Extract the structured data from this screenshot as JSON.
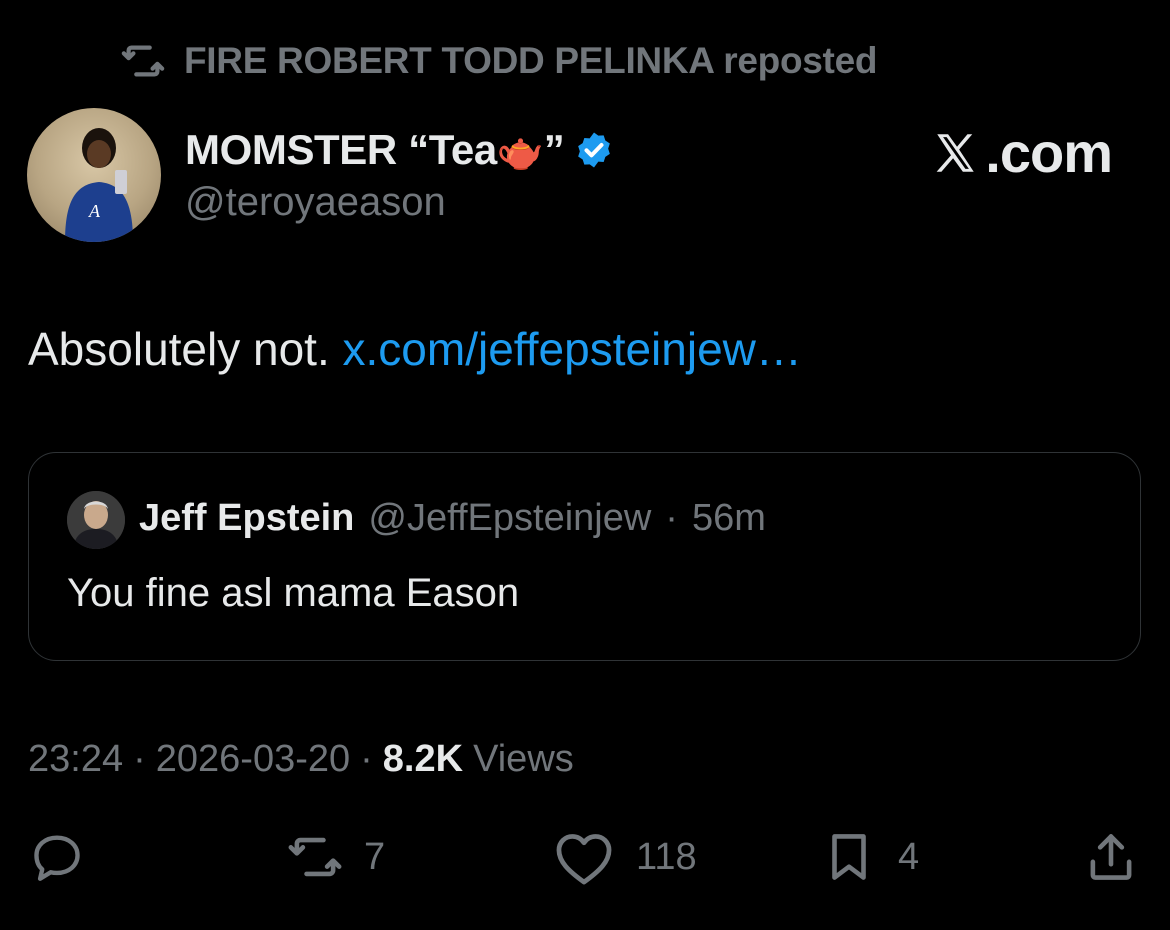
{
  "repost": {
    "text": "FIRE ROBERT TODD PELINKA reposted",
    "icon": "repost-icon"
  },
  "author": {
    "name": "MOMSTER “Tea",
    "name_suffix": "”",
    "handle": "@teroyaeason",
    "verified": true,
    "avatar_icon": "avatar"
  },
  "watermark": {
    "label": ".com",
    "glyph": "x-logo-icon"
  },
  "tweet": {
    "text": "Absolutely not.",
    "link": "x.com/jeffepsteinjew…"
  },
  "quote": {
    "name": "Jeff Epstein",
    "handle": "@JeffEpsteinjew",
    "separator": "·",
    "time": "56m",
    "text": "You fine asl mama Eason"
  },
  "meta": {
    "time": "23:24",
    "sep1": "·",
    "date": "2026-03-20",
    "sep2": "·",
    "views_count": "8.2K",
    "views_label": "Views"
  },
  "actions": {
    "reply": {
      "icon": "reply-icon"
    },
    "repost": {
      "icon": "repost-icon",
      "count": "7"
    },
    "like": {
      "icon": "heart-icon",
      "count": "118"
    },
    "bookmark": {
      "icon": "bookmark-icon",
      "count": "4"
    },
    "share": {
      "icon": "share-icon"
    }
  },
  "colors": {
    "background": "#000000",
    "text": "#e7e9ea",
    "muted": "#71767b",
    "link": "#1d9bf0",
    "verified": "#1d9bf0",
    "border": "#2f3336"
  }
}
